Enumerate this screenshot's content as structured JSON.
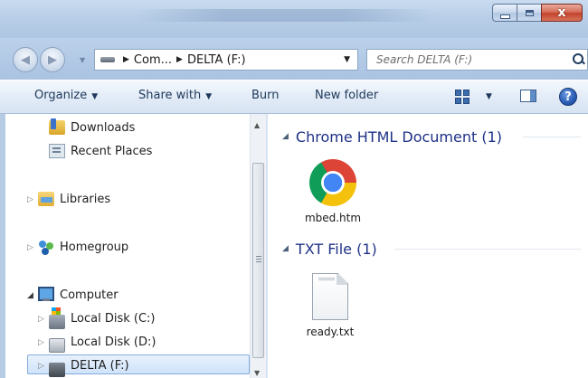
{
  "window": {
    "controls": {
      "minimize": "",
      "maximize": "",
      "close": "x"
    }
  },
  "address_bar": {
    "crumbs": [
      "Com...",
      "DELTA (F:)"
    ],
    "search_placeholder": "Search DELTA (F:)"
  },
  "command_bar": {
    "organize": "Organize",
    "share_with": "Share with",
    "burn": "Burn",
    "new_folder": "New folder",
    "help": "?"
  },
  "nav_pane": {
    "items": [
      {
        "label": "Downloads",
        "icon": "downloads-icon"
      },
      {
        "label": "Recent Places",
        "icon": "recent-places-icon"
      },
      {
        "label": "Libraries",
        "icon": "libraries-icon"
      },
      {
        "label": "Homegroup",
        "icon": "homegroup-icon"
      },
      {
        "label": "Computer",
        "icon": "computer-icon"
      },
      {
        "label": "Local Disk (C:)",
        "icon": "local-disk-icon"
      },
      {
        "label": "Local Disk (D:)",
        "icon": "local-disk-icon"
      },
      {
        "label": "DELTA (F:)",
        "icon": "removable-drive-icon",
        "selected": true
      }
    ]
  },
  "content": {
    "groups": [
      {
        "title": "Chrome HTML Document (1)",
        "files": [
          {
            "name": "mbed.htm",
            "icon": "chrome-icon"
          }
        ]
      },
      {
        "title": "TXT File (1)",
        "files": [
          {
            "name": "ready.txt",
            "icon": "text-file-icon"
          }
        ]
      }
    ]
  }
}
